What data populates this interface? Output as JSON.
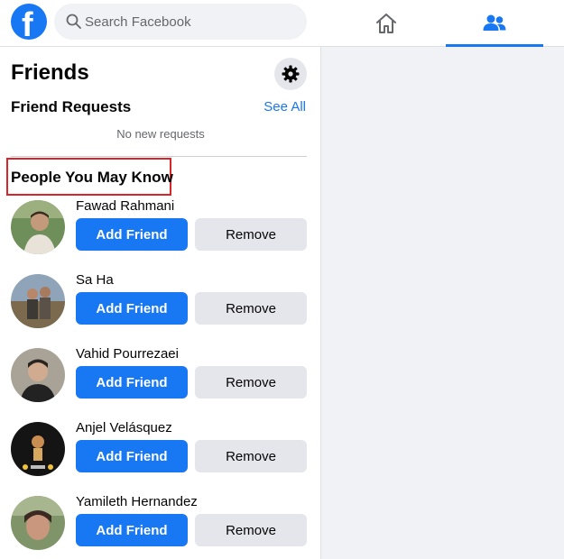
{
  "header": {
    "logo_letter": "f",
    "search": {
      "placeholder": "Search Facebook",
      "value": ""
    },
    "nav": {
      "active": "friends",
      "accent_color": "#1877f2"
    }
  },
  "friends_panel": {
    "title": "Friends",
    "friend_requests": {
      "title": "Friend Requests",
      "see_all": "See All",
      "empty_message": "No new requests"
    },
    "people_you_may_know": {
      "title": "People You May Know",
      "people": [
        {
          "name": "Fawad Rahmani",
          "add_label": "Add Friend",
          "remove_label": "Remove"
        },
        {
          "name": "Sa Ha",
          "add_label": "Add Friend",
          "remove_label": "Remove"
        },
        {
          "name": "Vahid Pourrezaei",
          "add_label": "Add Friend",
          "remove_label": "Remove"
        },
        {
          "name": "Anjel Velásquez",
          "add_label": "Add Friend",
          "remove_label": "Remove"
        },
        {
          "name": "Yamileth Hernandez",
          "add_label": "Add Friend",
          "remove_label": "Remove"
        }
      ]
    }
  },
  "colors": {
    "brand": "#1877f2",
    "secondary_button": "#e4e6eb",
    "page_background": "#f0f2f5",
    "highlight_box": "#d9252a"
  }
}
